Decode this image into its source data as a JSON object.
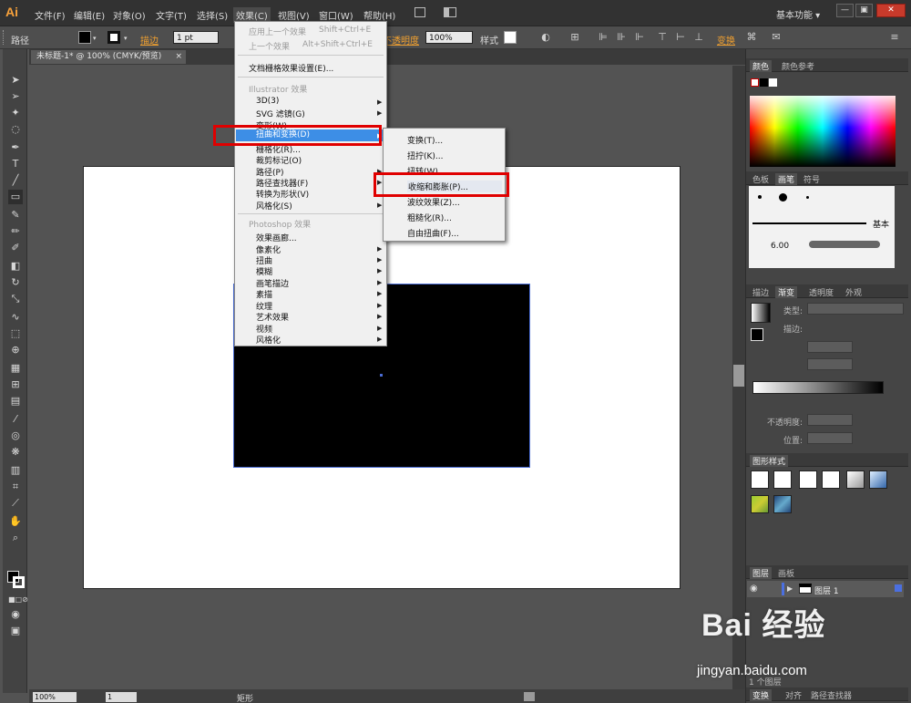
{
  "app": {
    "logo": "Ai",
    "workspace": "基本功能 ▾"
  },
  "menubar": {
    "items": [
      "文件(F)",
      "编辑(E)",
      "对象(O)",
      "文字(T)",
      "选择(S)",
      "效果(C)",
      "视图(V)",
      "窗口(W)",
      "帮助(H)"
    ]
  },
  "window_controls": {
    "minimize": "—",
    "restore": "▣",
    "close": "✕"
  },
  "controlbar": {
    "object_label": "路径",
    "stroke_label": "描边",
    "stroke_value": "1 pt",
    "opacity_label": "不透明度",
    "opacity_value": "100%",
    "style_label": "样式",
    "transform_label": "变换"
  },
  "document": {
    "tab_title": "未标题-1* @ 100% (CMYK/预览)",
    "tab_close": "×"
  },
  "statusbar": {
    "zoom": "100%",
    "page": "1",
    "status": "矩形"
  },
  "effect_menu": {
    "apply_last": "应用上一个效果",
    "apply_last_shortcut": "Shift+Ctrl+E",
    "last_effect": "上一个效果",
    "last_effect_shortcut": "Alt+Shift+Ctrl+E",
    "raster_settings": "文档栅格效果设置(E)...",
    "illustrator_header": "Illustrator 效果",
    "illustrator_items": [
      "3D(3)",
      "SVG 滤镜(G)",
      "变形(W)",
      "扭曲和变换(D)",
      "栅格化(R)...",
      "裁剪标记(O)",
      "路径(P)",
      "路径查找器(F)",
      "转换为形状(V)",
      "风格化(S)"
    ],
    "photoshop_header": "Photoshop 效果",
    "photoshop_items": [
      "效果画廊...",
      "像素化",
      "扭曲",
      "模糊",
      "画笔描边",
      "素描",
      "纹理",
      "艺术效果",
      "视频",
      "风格化"
    ]
  },
  "distort_submenu": {
    "items": [
      "变换(T)...",
      "扭拧(K)...",
      "扭转(W)...",
      "收缩和膨胀(P)...",
      "波纹效果(Z)...",
      "粗糙化(R)...",
      "自由扭曲(F)..."
    ]
  },
  "panels": {
    "color_tabs": [
      "颜色",
      "颜色参考"
    ],
    "brush_tabs": [
      "色板",
      "画笔",
      "符号"
    ],
    "brush_basic": "基本",
    "brush_size": "6.00",
    "gradient_tabs": [
      "描边",
      "渐变",
      "透明度",
      "外观"
    ],
    "gradient_type_label": "类型:",
    "gradient_stroke_label": "描边:",
    "gradient_opacity_label": "不透明度:",
    "gradient_location_label": "位置:",
    "graphic_styles_title": "图形样式",
    "layer_tabs": [
      "图层",
      "画板"
    ],
    "layer_name": "图层 1",
    "layer_count": "1 个图层",
    "bottom_tabs": [
      "变换",
      "对齐",
      "路径查找器"
    ]
  },
  "watermark": {
    "brand": "Bai  经验",
    "url": "jingyan.baidu.com"
  },
  "colors": {
    "highlight": "#3d8ee6",
    "callout": "#e00000",
    "menu_bg": "#f0f0f0",
    "accent": "#f0a030"
  }
}
